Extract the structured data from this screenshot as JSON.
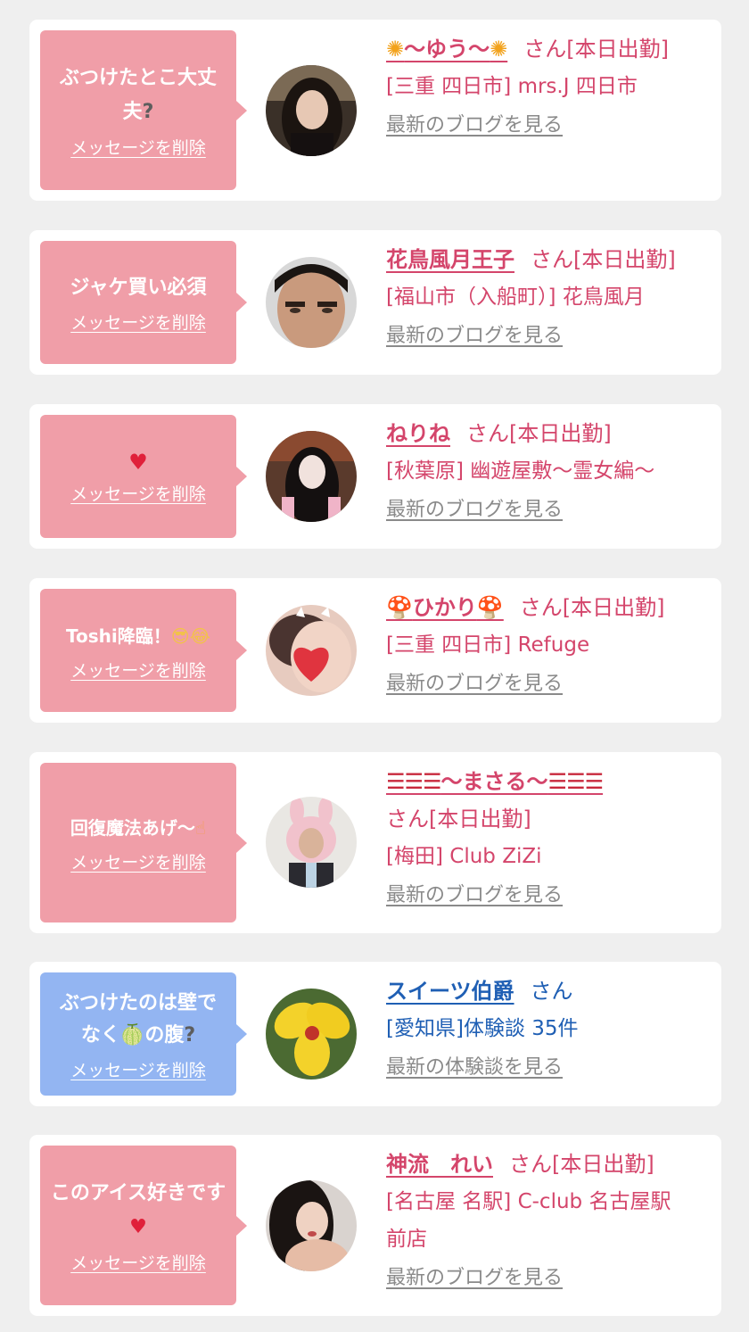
{
  "messages": [
    {
      "bubble_text": "ぶつけたとこ大丈夫",
      "bubble_suffix": "?",
      "delete_label": "メッセージを削除",
      "name": "〜ゆう〜",
      "name_prefix": "✺",
      "name_suffix": "✺",
      "status": "さん[本日出勤]",
      "shop": "[三重 四日市] mrs.J 四日市",
      "blog_label": "最新のブログを見る"
    },
    {
      "bubble_text": "ジャケ買い必須",
      "delete_label": "メッセージを削除",
      "name": "花鳥風月王子",
      "status": "さん[本日出勤]",
      "shop": "[福山市（入船町）] 花鳥風月",
      "blog_label": "最新のブログを見る"
    },
    {
      "bubble_text": "♥",
      "delete_label": "メッセージを削除",
      "name": "ねりね",
      "status": "さん[本日出勤]",
      "shop": "[秋葉原] 幽遊屋敷〜霊女編〜",
      "blog_label": "最新のブログを見る"
    },
    {
      "bubble_text": "Toshi降臨！",
      "bubble_suffix": "😎😂",
      "delete_label": "メッセージを削除",
      "name": "ひかり",
      "name_prefix": "🍄",
      "name_suffix": "🍄",
      "status": "さん[本日出勤]",
      "shop": "[三重 四日市] Refuge",
      "blog_label": "最新のブログを見る"
    },
    {
      "bubble_text": "回復魔法あげ〜",
      "bubble_suffix": "☝",
      "delete_label": "メッセージを削除",
      "name": "〜まさる〜",
      "name_prefix": "☰☰☰",
      "name_suffix": "☰☰☰",
      "status": "さん[本日出勤]",
      "shop": "[梅田] Club ZiZi",
      "blog_label": "最新のブログを見る"
    },
    {
      "bubble_text_1": "ぶつけたのは壁で",
      "bubble_text_2": "なく",
      "bubble_text_3": "の腹",
      "bubble_emoji": "🍈",
      "bubble_suffix": "?",
      "delete_label": "メッセージを削除",
      "name": "スイーツ伯爵",
      "status": "さん",
      "shop": "[愛知県]体験談 35件",
      "blog_label": "最新の体験談を見る"
    },
    {
      "bubble_text": "このアイス好きです",
      "bubble_suffix": "♥",
      "delete_label": "メッセージを削除",
      "name": "神流　れい",
      "status": "さん[本日出勤]",
      "shop_line1": "[名古屋 名駅] C-club 名古屋駅",
      "shop_line2": "前店",
      "blog_label": "最新のブログを見る"
    }
  ],
  "colors": {
    "bubble_pink": "#f09ea8",
    "bubble_blue": "#93b5f2",
    "name_pink": "#d4456b",
    "name_blue": "#1f5fb4",
    "blog_gray": "#8a8a8a"
  },
  "icons": [
    "flower-icon",
    "mushroom-icon",
    "thai-flag-icon",
    "heart-icon",
    "question-mark-icon",
    "sunglasses-emoji-icon",
    "laughing-emoji-icon",
    "pointing-finger-icon",
    "melon-icon"
  ]
}
